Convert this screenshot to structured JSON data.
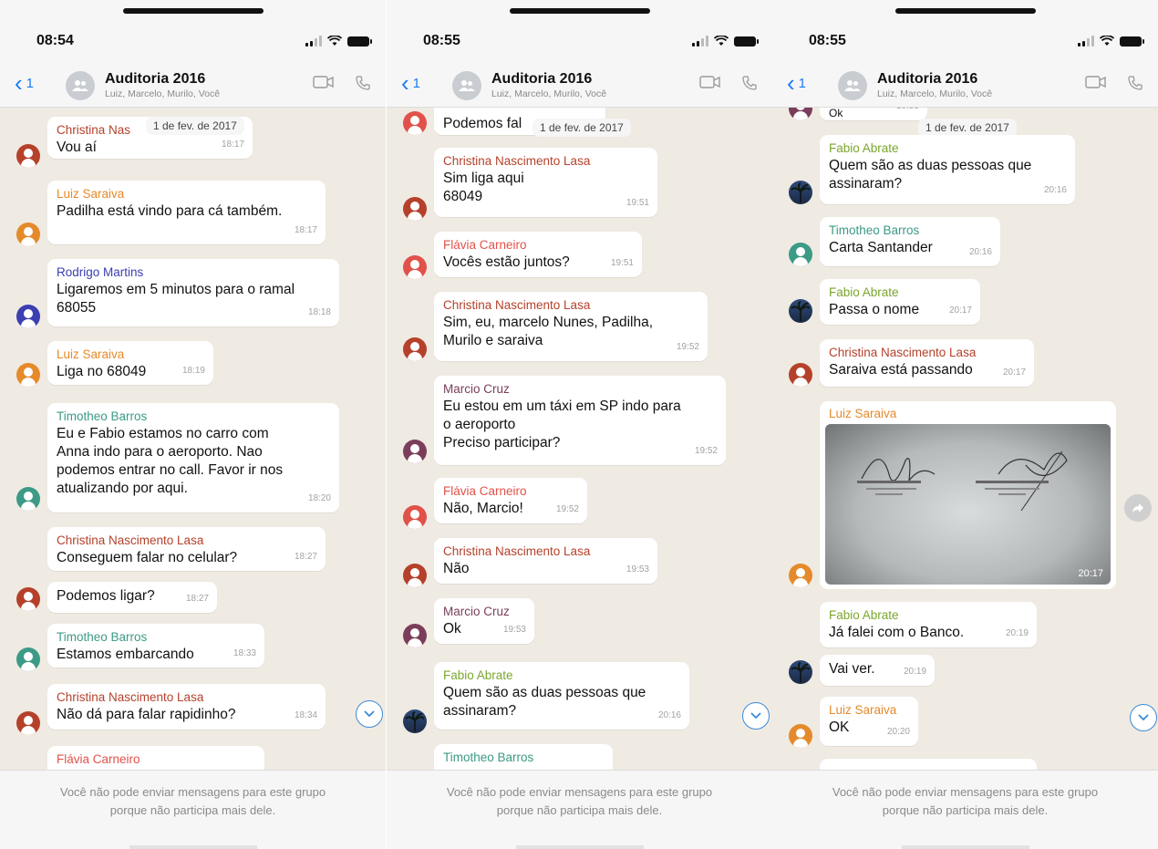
{
  "colors": {
    "link": "#1a7cf5",
    "christina": "#b5412b",
    "luiz": "#e58a2a",
    "rodrigo": "#3b3fb0",
    "timotheo": "#3c9a86",
    "flavia": "#e0524a",
    "marcio": "#7a3e5a",
    "fabio": "#7aa62c"
  },
  "phones": [
    {
      "status_time": "08:54",
      "back_count": "1",
      "group_name": "Auditoria 2016",
      "group_members": "Luiz, Marcelo, Murilo, Você",
      "date_pill": "1 de fev. de 2017",
      "messages": [
        {
          "sender": "Christina Nas",
          "text": "Vou aí",
          "time": "18:17"
        },
        {
          "sender": "Luiz Saraiva",
          "text": "Padilha está vindo para cá também.",
          "time": "18:17"
        },
        {
          "sender": "Rodrigo Martins",
          "text": "Ligaremos em 5 minutos para o ramal\n68055",
          "time": "18:18"
        },
        {
          "sender": "Luiz Saraiva",
          "text": "Liga no 68049",
          "time": "18:19"
        },
        {
          "sender": "Timotheo Barros",
          "text": "Eu e Fabio estamos no carro com\nAnna indo para o aeroporto. Nao\npodemos entrar no call. Favor ir nos\natualizando por aqui.",
          "time": "18:20"
        },
        {
          "sender": "Christina Nascimento Lasa",
          "text": "Conseguem falar no celular?",
          "time": "18:27"
        },
        {
          "sender": "",
          "text": "Podemos ligar?",
          "time": "18:27"
        },
        {
          "sender": "Timotheo Barros",
          "text": "Estamos embarcando",
          "time": "18:33"
        },
        {
          "sender": "Christina Nascimento Lasa",
          "text": "Não dá para falar rapidinho?",
          "time": "18:34"
        },
        {
          "sender": "Flávia Carneiro",
          "text": "",
          "time": ""
        }
      ],
      "footer": "Você não pode enviar mensagens para este grupo\nporque não participa mais dele."
    },
    {
      "status_time": "08:55",
      "back_count": "1",
      "group_name": "Auditoria 2016",
      "group_members": "Luiz, Marcelo, Murilo, Você",
      "date_pill": "1 de fev. de 2017",
      "messages": [
        {
          "sender": "",
          "text": "Podemos fal",
          "time": ""
        },
        {
          "sender": "Christina Nascimento Lasa",
          "text": "Sim liga aqui\n68049",
          "time": "19:51"
        },
        {
          "sender": "Flávia Carneiro",
          "text": "Vocês estão juntos?",
          "time": "19:51"
        },
        {
          "sender": "Christina Nascimento Lasa",
          "text": "Sim, eu, marcelo Nunes, Padilha,\nMurilo e saraiva",
          "time": "19:52"
        },
        {
          "sender": "Marcio Cruz",
          "text": "Eu estou em um táxi em SP indo para\no aeroporto\nPreciso participar?",
          "time": "19:52"
        },
        {
          "sender": "Flávia Carneiro",
          "text": "Não, Marcio!",
          "time": "19:52"
        },
        {
          "sender": "Christina Nascimento Lasa",
          "text": "Não",
          "time": "19:53"
        },
        {
          "sender": "Marcio Cruz",
          "text": "Ok",
          "time": "19:53"
        },
        {
          "sender": "Fabio Abrate",
          "text": "Quem são as duas pessoas que\nassinaram?",
          "time": "20:16"
        },
        {
          "sender": "Timotheo Barros",
          "text": "",
          "time": ""
        }
      ],
      "footer": "Você não pode enviar mensagens para este grupo\nporque não participa mais dele."
    },
    {
      "status_time": "08:55",
      "back_count": "1",
      "group_name": "Auditoria 2016",
      "group_members": "Luiz, Marcelo, Murilo, Você",
      "date_pill": "1 de fev. de 2017",
      "messages": [
        {
          "sender": "",
          "text": "Ok",
          "time": "19:53"
        },
        {
          "sender": "Fabio Abrate",
          "text": "Quem são as duas pessoas que\nassinaram?",
          "time": "20:16"
        },
        {
          "sender": "Timotheo Barros",
          "text": "Carta Santander",
          "time": "20:16"
        },
        {
          "sender": "Fabio Abrate",
          "text": "Passa o nome",
          "time": "20:17"
        },
        {
          "sender": "Christina Nascimento Lasa",
          "text": "Saraiva está passando",
          "time": "20:17"
        },
        {
          "sender": "Luiz Saraiva",
          "text": "",
          "time": "20:17"
        },
        {
          "sender": "Fabio Abrate",
          "text": "Já falei com o Banco.",
          "time": "20:19"
        },
        {
          "sender": "",
          "text": "Vai ver.",
          "time": "20:19"
        },
        {
          "sender": "Luiz Saraiva",
          "text": "OK",
          "time": "20:20"
        }
      ],
      "footer": "Você não pode enviar mensagens para este grupo\nporque não participa mais dele."
    }
  ]
}
